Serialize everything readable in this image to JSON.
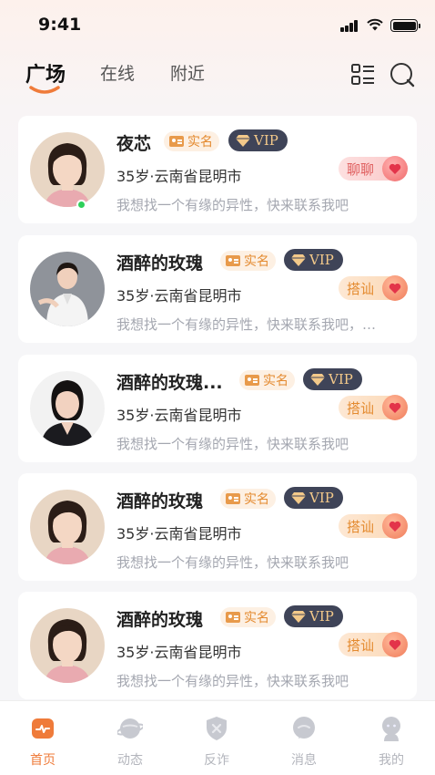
{
  "status_bar": {
    "time": "9:41"
  },
  "header": {
    "tabs": [
      {
        "label": "广场",
        "active": true
      },
      {
        "label": "在线",
        "active": false
      },
      {
        "label": "附近",
        "active": false
      }
    ],
    "icons": [
      "list-grid-icon",
      "search-icon"
    ]
  },
  "colors": {
    "accent": "#ef7b3a",
    "vip_bg": "#3f4458",
    "online": "#2fcf5a"
  },
  "users": [
    {
      "name": "夜芯",
      "verified_label": "实名",
      "vip_label": "VIP",
      "info": "35岁·云南省昆明市",
      "desc": "我想找一个有缘的异性，快来联系我吧",
      "action": "聊聊",
      "online": true
    },
    {
      "name": "酒醉的玫瑰",
      "verified_label": "实名",
      "vip_label": "VIP",
      "info": "35岁·云南省昆明市",
      "desc": "我想找一个有缘的异性，快来联系我吧，…",
      "action": "搭讪",
      "online": false
    },
    {
      "name": "酒醉的玫瑰...",
      "verified_label": "实名",
      "vip_label": "VIP",
      "info": "35岁·云南省昆明市",
      "desc": "我想找一个有缘的异性，快来联系我吧",
      "action": "搭讪",
      "online": false
    },
    {
      "name": "酒醉的玫瑰",
      "verified_label": "实名",
      "vip_label": "VIP",
      "info": "35岁·云南省昆明市",
      "desc": "我想找一个有缘的异性，快来联系我吧",
      "action": "搭讪",
      "online": false
    },
    {
      "name": "酒醉的玫瑰",
      "verified_label": "实名",
      "vip_label": "VIP",
      "info": "35岁·云南省昆明市",
      "desc": "我想找一个有缘的异性，快来联系我吧",
      "action": "搭讪",
      "online": false
    }
  ],
  "bottom_nav": [
    {
      "label": "首页",
      "icon": "home-icon",
      "active": true
    },
    {
      "label": "动态",
      "icon": "planet-icon",
      "active": false
    },
    {
      "label": "反诈",
      "icon": "shield-icon",
      "active": false
    },
    {
      "label": "消息",
      "icon": "message-icon",
      "active": false
    },
    {
      "label": "我的",
      "icon": "profile-icon",
      "active": false
    }
  ]
}
